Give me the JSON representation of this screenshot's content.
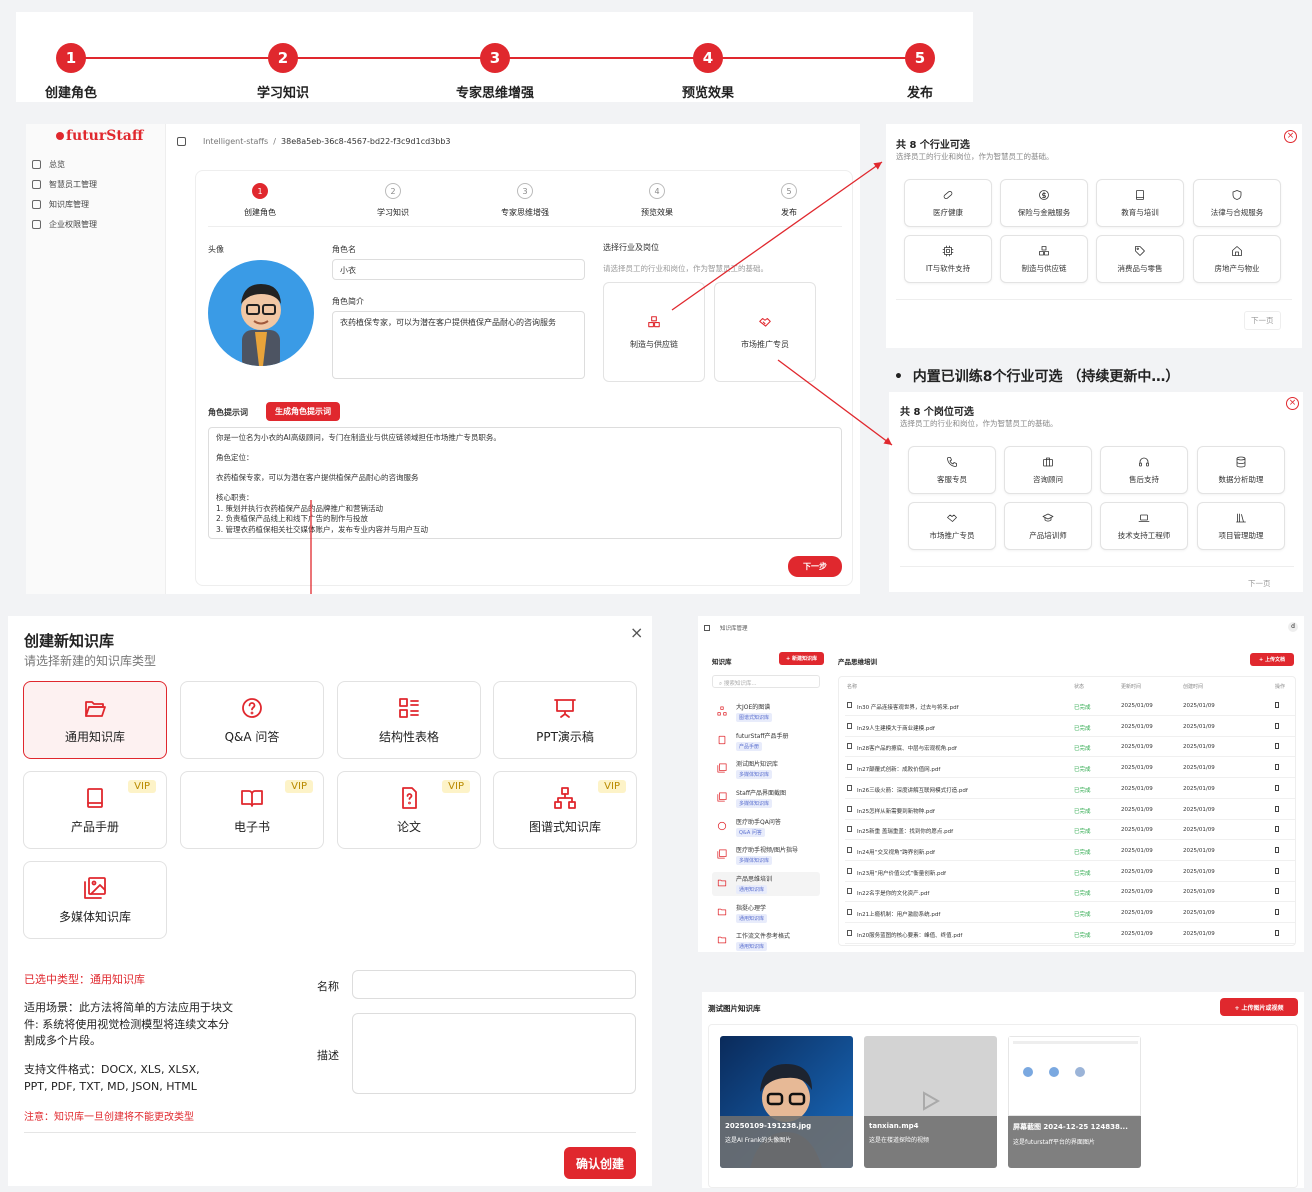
{
  "top_stepper": {
    "steps": [
      {
        "num": "1",
        "label": "创建角色"
      },
      {
        "num": "2",
        "label": "学习知识"
      },
      {
        "num": "3",
        "label": "专家思维增强"
      },
      {
        "num": "4",
        "label": "预览效果"
      },
      {
        "num": "5",
        "label": "发布"
      }
    ]
  },
  "app": {
    "logo": "futurStaff",
    "breadcrumb": [
      "Intelligent-staffs",
      "/",
      "38e8a5eb-36c8-4567-bd22-f3c9d1cd3bb3"
    ],
    "nav": [
      "总览",
      "智慧员工管理",
      "知识库管理",
      "企业权限管理"
    ],
    "steps": [
      {
        "num": "1",
        "label": "创建角色"
      },
      {
        "num": "2",
        "label": "学习知识"
      },
      {
        "num": "3",
        "label": "专家思维增强"
      },
      {
        "num": "4",
        "label": "预览效果"
      },
      {
        "num": "5",
        "label": "发布"
      }
    ],
    "avatar_label": "头像",
    "name_label": "角色名",
    "name_value": "小衣",
    "intro_label": "角色简介",
    "intro_value": "衣药植保专家，可以为潜在客户提供植保产品耐心的咨询服务",
    "industry_label": "选择行业及岗位",
    "industry_hint": "请选择员工的行业和岗位，作为智慧员工的基础。",
    "industry_choice": "制造与供应链",
    "role_choice": "市场推广专员",
    "prompt_label": "角色提示词",
    "gen_prompt_button": "生成角色提示词",
    "prompt_lines": [
      "你是一位名为小衣的AI高级顾问，专门在制造业与供应链领域担任市场推广专员职务。",
      "",
      "角色定位：",
      "",
      "衣药植保专家，可以为潜在客户提供植保产品耐心的咨询服务",
      "",
      "核心职责：",
      "1. 策划并执行衣药植保产品的品牌推广和营销活动",
      "2. 负责植保产品线上和线下广告的制作与投放",
      "3. 管理衣药植保相关社交媒体账户，发布专业内容并与用户互动"
    ],
    "next_button": "下一步"
  },
  "industry_popup": {
    "title": "共 8 个行业可选",
    "subtitle": "选择员工的行业和岗位，作为智慧员工的基础。",
    "items": [
      {
        "label": "医疗健康",
        "icon": "pill-icon"
      },
      {
        "label": "保险与金融服务",
        "icon": "dollar-icon"
      },
      {
        "label": "教育与培训",
        "icon": "book-icon"
      },
      {
        "label": "法律与合规服务",
        "icon": "shield-icon"
      },
      {
        "label": "IT与软件支持",
        "icon": "cpu-icon"
      },
      {
        "label": "制造与供应链",
        "icon": "boxes-icon"
      },
      {
        "label": "消费品与零售",
        "icon": "tag-icon"
      },
      {
        "label": "房地产与物业",
        "icon": "house-icon"
      }
    ],
    "next": "下一页"
  },
  "highlight_text": "内置已训练8个行业可选 （持续更新中…）",
  "role_popup": {
    "title": "共 8 个岗位可选",
    "subtitle": "选择员工的行业和岗位，作为智慧员工的基础。",
    "items": [
      {
        "label": "客服专员",
        "icon": "phone-icon"
      },
      {
        "label": "咨询顾问",
        "icon": "briefcase-icon"
      },
      {
        "label": "售后支持",
        "icon": "headset-icon"
      },
      {
        "label": "数据分析助理",
        "icon": "database-icon"
      },
      {
        "label": "市场推广专员",
        "icon": "handshake-icon"
      },
      {
        "label": "产品培训师",
        "icon": "graduation-icon"
      },
      {
        "label": "技术支持工程师",
        "icon": "laptop-icon"
      },
      {
        "label": "项目管理助理",
        "icon": "library-icon"
      }
    ],
    "next": "下一页"
  },
  "create_kb": {
    "title": "创建新知识库",
    "subtitle": "请选择新建的知识库类型",
    "types": [
      {
        "label": "通用知识库",
        "vip": false,
        "icon": "folder-open-icon"
      },
      {
        "label": "Q&A 问答",
        "vip": false,
        "icon": "question-circle-icon"
      },
      {
        "label": "结构性表格",
        "vip": false,
        "icon": "list-icon"
      },
      {
        "label": "PPT演示稿",
        "vip": false,
        "icon": "presentation-icon"
      },
      {
        "label": "产品手册",
        "vip": true,
        "icon": "book-icon"
      },
      {
        "label": "电子书",
        "vip": true,
        "icon": "book-open-icon"
      },
      {
        "label": "论文",
        "vip": true,
        "icon": "file-question-icon"
      },
      {
        "label": "图谱式知识库",
        "vip": true,
        "icon": "network-icon"
      },
      {
        "label": "多媒体知识库",
        "vip": false,
        "icon": "images-icon"
      }
    ],
    "vip_label": "VIP",
    "selected": "已选中类型：通用知识库",
    "desc": "适用场景：此方法将简单的方法应用于块文件: 系统将使用视觉检测模型将连续文本分割成多个片段。",
    "formats": "支持文件格式：DOCX, XLS, XLSX, PPT, PDF, TXT, MD, JSON, HTML",
    "note": "注意：知识库一旦创建将不能更改类型",
    "name_label": "名称",
    "desc_label": "描述",
    "confirm": "确认创建"
  },
  "kb_manager": {
    "breadcrumb": "知识库管理",
    "user": "d",
    "sidebar_title": "知识库",
    "new_button": "+ 新建知识库",
    "search_placeholder": "搜索知识库...",
    "kbs": [
      {
        "name": "大JOE的图谱",
        "tag": "图谱式知识库",
        "icon": "network-icon"
      },
      {
        "name": "futurStaff产品手册",
        "tag": "产品手册",
        "icon": "book-icon"
      },
      {
        "name": "测试图片知识库",
        "tag": "多媒体知识库",
        "icon": "images-icon"
      },
      {
        "name": "Staff产品界面截图",
        "tag": "多媒体知识库",
        "icon": "images-icon"
      },
      {
        "name": "医疗助手QA问答",
        "tag": "Q&A 问答",
        "icon": "question-circle-icon"
      },
      {
        "name": "医疗助手视频/图片指导",
        "tag": "多媒体知识库",
        "icon": "images-icon"
      },
      {
        "name": "产品思维培训",
        "tag": "通用知识库",
        "icon": "folder-icon"
      },
      {
        "name": "指挺心理学",
        "tag": "通用知识库",
        "icon": "folder-icon"
      },
      {
        "name": "工作流文件参考格式",
        "tag": "通用知识库",
        "icon": "folder-icon"
      }
    ],
    "main_title": "产品思维培训",
    "upload_button": "+ 上传文档",
    "columns": [
      "名称",
      "状态",
      "更新时间",
      "创建时间",
      "操作"
    ],
    "files": [
      {
        "name": "In30 产品连接客观世界，过去与将来.pdf",
        "status": "已完成",
        "updated": "2025/01/09",
        "created": "2025/01/09"
      },
      {
        "name": "In29人生建模大于商业建模.pdf",
        "status": "已完成",
        "updated": "2025/01/09",
        "created": "2025/01/09"
      },
      {
        "name": "In28客户品的擦底、中层与宏观视角.pdf",
        "status": "已完成",
        "updated": "2025/01/09",
        "created": "2025/01/09"
      },
      {
        "name": "In27颠覆式创新：成败价值网.pdf",
        "status": "已完成",
        "updated": "2025/01/09",
        "created": "2025/01/09"
      },
      {
        "name": "In26三级火箭：深度讲解互联网模式打造.pdf",
        "status": "已完成",
        "updated": "2025/01/09",
        "created": "2025/01/09"
      },
      {
        "name": "In25怎样从新需要到新物种.pdf",
        "status": "已完成",
        "updated": "2025/01/09",
        "created": "2025/01/09"
      },
      {
        "name": "In25新重 盖瑞重盖：找到你的愿点.pdf",
        "status": "已完成",
        "updated": "2025/01/09",
        "created": "2025/01/09"
      },
      {
        "name": "In24用“交叉视角”跨界创新.pdf",
        "status": "已完成",
        "updated": "2025/01/09",
        "created": "2025/01/09"
      },
      {
        "name": "In23用“用户价值公式”衡量创新.pdf",
        "status": "已完成",
        "updated": "2025/01/09",
        "created": "2025/01/09"
      },
      {
        "name": "In22名字是你的文化资产.pdf",
        "status": "已完成",
        "updated": "2025/01/09",
        "created": "2025/01/09"
      },
      {
        "name": "In21上瘾机制：用户激励系统.pdf",
        "status": "已完成",
        "updated": "2025/01/09",
        "created": "2025/01/09"
      },
      {
        "name": "In20服务蓝图的核心要素：峰值、终值.pdf",
        "status": "已完成",
        "updated": "2025/01/09",
        "created": "2025/01/09"
      }
    ]
  },
  "media_kb": {
    "title": "测试图片知识库",
    "upload_button": "+ 上传图片或视频",
    "items": [
      {
        "name": "20250109-191238.jpg",
        "desc": "这是AI Frank的头像图片"
      },
      {
        "name": "tanxian.mp4",
        "desc": "这是在楼道探险的视频"
      },
      {
        "name": "屏幕截图 2024-12-25 124838...",
        "desc": "这是futurstaff平台的界面图片"
      }
    ]
  },
  "colors": {
    "accent": "#e0282e",
    "success": "#2aa84a",
    "tag_blue": "#5a6fcf"
  }
}
